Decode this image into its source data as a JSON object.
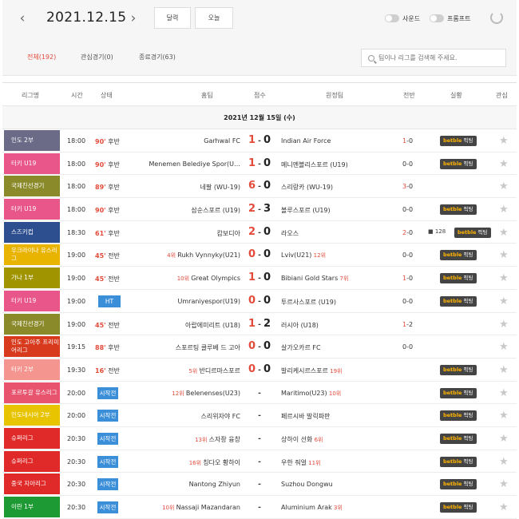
{
  "header": {
    "date": "2021.12.15",
    "prev_icon": "chevron-left-icon",
    "next_icon": "chevron-right-icon",
    "calendar_label": "달력",
    "today_label": "오늘",
    "sound_label": "사운드",
    "prompt_label": "프롬프트",
    "refresh_icon": "refresh-icon"
  },
  "tabs": [
    {
      "label": "전체(192)",
      "active": true
    },
    {
      "label": "관심경기(0)",
      "active": false
    },
    {
      "label": "종료경기(63)",
      "active": false
    }
  ],
  "search": {
    "placeholder": "팀이나 리그를 검색해 주세요."
  },
  "columns": {
    "league": "리그명",
    "time": "시간",
    "status": "상태",
    "home": "홈팀",
    "score": "점수",
    "away": "원정팀",
    "half": "전반",
    "live": "실황",
    "fav": "관심"
  },
  "day_header": "2021년 12월 15일 (수)",
  "bet_label": {
    "brand": "betble",
    "suffix": "픽팅"
  },
  "colors": {
    "accent": "#e34b3b",
    "status_blue": "#3b8fd9"
  },
  "matches": [
    {
      "league": "인도 2부",
      "color": "#6b6b88",
      "time": "18:00",
      "status": "90' 후반",
      "home": "Garhwal FC",
      "home_rank": "",
      "score_h": "1",
      "score_a": "0",
      "away": "Indian Air Force",
      "away_rank": "",
      "half_h": "1",
      "half_a": "0",
      "bet": true,
      "views": ""
    },
    {
      "league": "터키 U19",
      "color": "#e8568a",
      "time": "18:00",
      "status": "90' 후반",
      "home": "Menemen Belediye Spor(U…",
      "home_rank": "",
      "score_h": "1",
      "score_a": "0",
      "away": "메니멘볼리스포르 (U19)",
      "away_rank": "",
      "half_h": "0",
      "half_a": "0",
      "bet": true,
      "views": ""
    },
    {
      "league": "국제친선경기",
      "color": "#8a8a2a",
      "time": "18:00",
      "status": "89' 후반",
      "home": "네팔 (WU-19)",
      "home_rank": "",
      "score_h": "6",
      "score_a": "0",
      "away": "스리랑카 (WU-19)",
      "away_rank": "",
      "half_h": "3",
      "half_a": "0",
      "bet": false,
      "views": ""
    },
    {
      "league": "터키 U19",
      "color": "#e8568a",
      "time": "18:00",
      "status": "90' 후반",
      "home": "삼순스포르 (U19)",
      "home_rank": "",
      "score_h": "2",
      "score_a": "3",
      "away": "볼루스포르 (U19)",
      "away_rank": "",
      "half_h": "0",
      "half_a": "0",
      "bet": true,
      "views": ""
    },
    {
      "league": "스즈키컵",
      "color": "#2e4f8f",
      "time": "18:30",
      "status": "61' 후반",
      "home": "캄보디아",
      "home_rank": "",
      "score_h": "2",
      "score_a": "0",
      "away": "라오스",
      "away_rank": "",
      "half_h": "2",
      "half_a": "0",
      "bet": true,
      "views": "128"
    },
    {
      "league": "우크라이나 유스리그",
      "color": "#e8b400",
      "time": "19:00",
      "status": "45' 전반",
      "home": "Rukh Vynnyky(U21)",
      "home_rank": "4위",
      "score_h": "0",
      "score_a": "0",
      "away": "Lviv(U21)",
      "away_rank": "12위",
      "half_h": "0",
      "half_a": "0",
      "bet": true,
      "views": ""
    },
    {
      "league": "가나 1부",
      "color": "#a09400",
      "time": "19:00",
      "status": "45' 전반",
      "home": "Great Olympics",
      "home_rank": "10위",
      "score_h": "1",
      "score_a": "0",
      "away": "Bibiani Gold Stars",
      "away_rank": "7위",
      "half_h": "1",
      "half_a": "0",
      "bet": true,
      "views": ""
    },
    {
      "league": "터키 U19",
      "color": "#e8568a",
      "time": "19:00",
      "status": "HT",
      "home": "Umraniyespor(U19)",
      "home_rank": "",
      "score_h": "0",
      "score_a": "0",
      "away": "투르사스포르 (U19)",
      "away_rank": "",
      "half_h": "0",
      "half_a": "0",
      "bet": true,
      "views": ""
    },
    {
      "league": "국제친선경기",
      "color": "#8a8a2a",
      "time": "19:00",
      "status": "45' 전반",
      "home": "아랍에미리트 (U18)",
      "home_rank": "",
      "score_h": "1",
      "score_a": "2",
      "away": "러시아 (U18)",
      "away_rank": "",
      "half_h": "1",
      "half_a": "2",
      "bet": false,
      "views": ""
    },
    {
      "league": "인도 고아주 프리미어리그",
      "color": "#d83a1e",
      "time": "19:15",
      "status": "88' 후반",
      "home": "스포르팅 클루베 드 고아",
      "home_rank": "",
      "score_h": "0",
      "score_a": "0",
      "away": "살가오카르 FC",
      "away_rank": "",
      "half_h": "0",
      "half_a": "0",
      "bet": false,
      "views": ""
    },
    {
      "league": "터키 2부",
      "color": "#f4958f",
      "time": "19:30",
      "status": "16' 전반",
      "home": "반디르마스포르",
      "home_rank": "5위",
      "score_h": "0",
      "score_a": "0",
      "away": "발리케시르스포르",
      "away_rank": "19위",
      "half_h": "",
      "half_a": "",
      "bet": true,
      "views": ""
    },
    {
      "league": "포르투갈 유스리그",
      "color": "#e8546e",
      "time": "20:00",
      "status": "시작전",
      "home": "Belenenses(U23)",
      "home_rank": "12위",
      "score_h": "",
      "score_a": "",
      "away": "Maritimo(U23)",
      "away_rank": "10위",
      "half_h": "",
      "half_a": "",
      "bet": true,
      "views": ""
    },
    {
      "league": "인도네시아 2부",
      "color": "#e8c400",
      "time": "20:00",
      "status": "시작전",
      "home": "스리위자야 FC",
      "home_rank": "",
      "score_h": "",
      "score_a": "",
      "away": "페르시바 발릭파판",
      "away_rank": "",
      "half_h": "",
      "half_a": "",
      "bet": true,
      "views": ""
    },
    {
      "league": "슈퍼리그",
      "color": "#e02a2a",
      "time": "20:30",
      "status": "시작전",
      "home": "스자좡 융창",
      "home_rank": "13위",
      "score_h": "",
      "score_a": "",
      "away": "상하이 선화",
      "away_rank": "6위",
      "half_h": "",
      "half_a": "",
      "bet": true,
      "views": ""
    },
    {
      "league": "슈퍼리그",
      "color": "#e02a2a",
      "time": "20:30",
      "status": "시작전",
      "home": "칭다오 황하이",
      "home_rank": "16위",
      "score_h": "",
      "score_a": "",
      "away": "우한 줘얼",
      "away_rank": "11위",
      "half_h": "",
      "half_a": "",
      "bet": true,
      "views": ""
    },
    {
      "league": "중국 지아리그",
      "color": "#e02a2a",
      "time": "20:30",
      "status": "시작전",
      "home": "Nantong Zhiyun",
      "home_rank": "",
      "score_h": "",
      "score_a": "",
      "away": "Suzhou Dongwu",
      "away_rank": "",
      "half_h": "",
      "half_a": "",
      "bet": true,
      "views": ""
    },
    {
      "league": "이란 1부",
      "color": "#1e9a34",
      "time": "20:30",
      "status": "시작전",
      "home": "Nassaji Mazandaran",
      "home_rank": "10위",
      "score_h": "",
      "score_a": "",
      "away": "Aluminium Arak",
      "away_rank": "3위",
      "half_h": "",
      "half_a": "",
      "bet": true,
      "views": ""
    }
  ]
}
